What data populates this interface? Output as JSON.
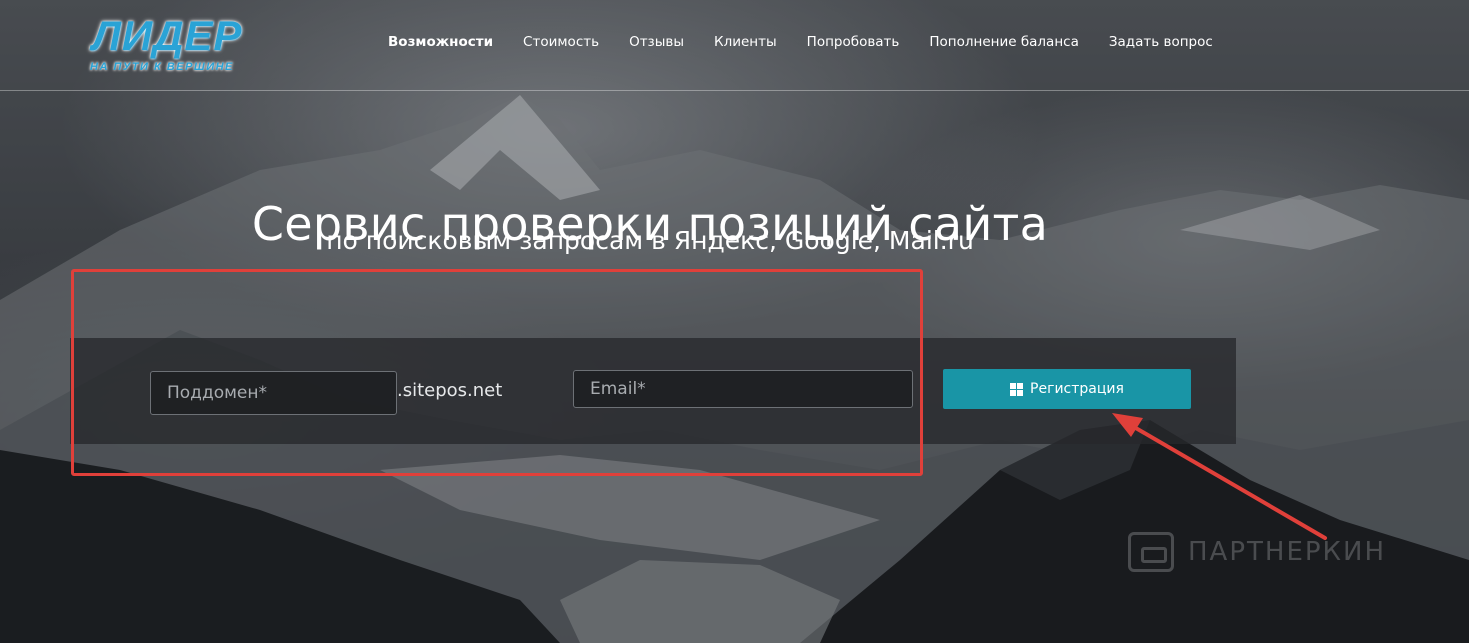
{
  "logo": {
    "main": "ЛИДЕР",
    "tagline": "НА ПУТИ К ВЕРШИНЕ"
  },
  "nav": {
    "items": [
      {
        "label": "Возможности",
        "active": true
      },
      {
        "label": "Стоимость"
      },
      {
        "label": "Отзывы"
      },
      {
        "label": "Клиенты"
      },
      {
        "label": "Попробовать"
      },
      {
        "label": "Пополнение баланса"
      },
      {
        "label": "Задать вопрос"
      }
    ]
  },
  "hero": {
    "title": "Сервис проверки позиций сайта",
    "subtitle": "по поисковым запросам в Яндекс, Google, Mail.ru"
  },
  "form": {
    "subdomain_placeholder": "Поддомен*",
    "subdomain_value": "",
    "domain_suffix": ".sitepos.net",
    "email_placeholder": "Email*",
    "email_value": "",
    "register_label": "Регистрация",
    "register_icon": "windows-icon",
    "button_color": "#1995a6"
  },
  "annotations": {
    "highlight_color": "#e0403a"
  },
  "watermark": {
    "text": "ПАРТНЕРКИН"
  }
}
